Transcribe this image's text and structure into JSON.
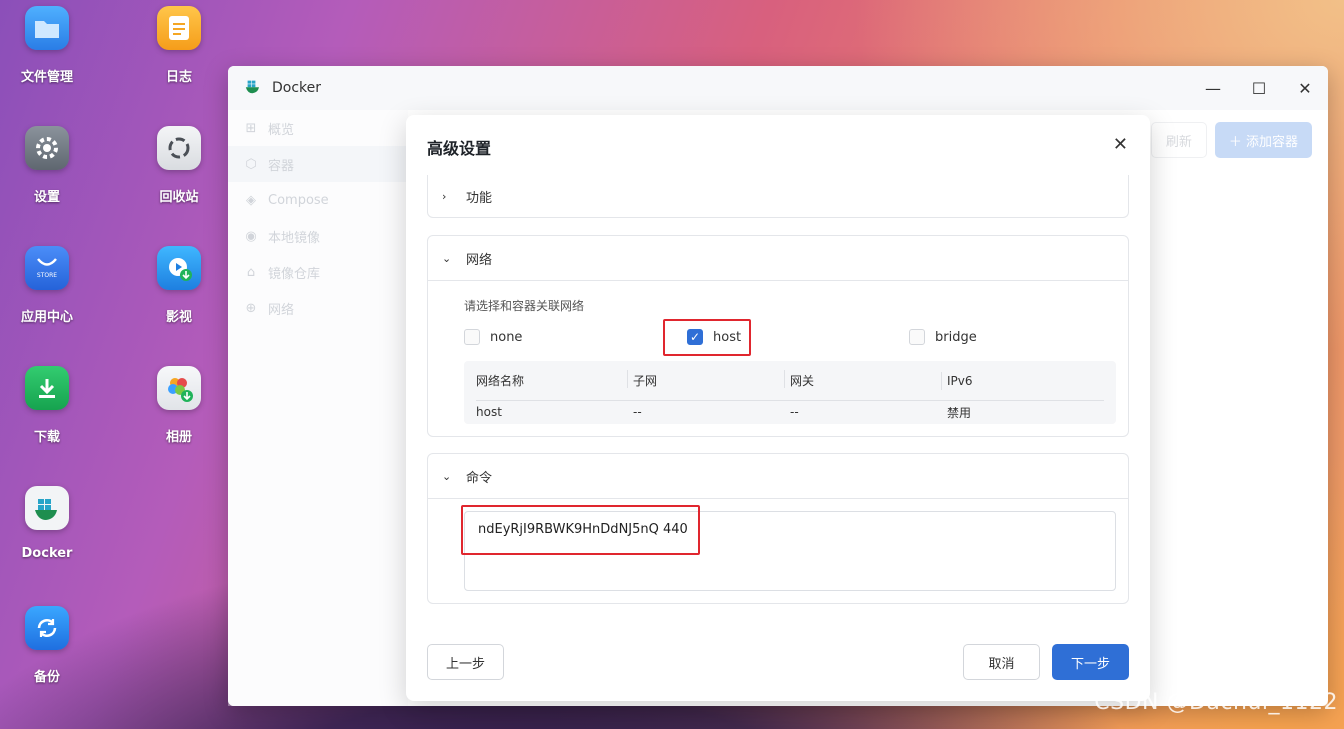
{
  "desktop": {
    "icons": [
      {
        "label": "文件管理",
        "icon": "folder-icon"
      },
      {
        "label": "日志",
        "icon": "log-icon"
      },
      {
        "label": "设置",
        "icon": "gear-icon"
      },
      {
        "label": "回收站",
        "icon": "recycle-icon"
      },
      {
        "label": "应用中心",
        "icon": "store-icon",
        "badge": "STORE"
      },
      {
        "label": "影视",
        "icon": "video-icon"
      },
      {
        "label": "下载",
        "icon": "download-icon"
      },
      {
        "label": "相册",
        "icon": "photos-icon"
      },
      {
        "label": "Docker",
        "icon": "docker-icon"
      },
      {
        "label": "备份",
        "icon": "backup-icon"
      }
    ]
  },
  "window": {
    "title": "Docker",
    "controls": {
      "minimize": "—",
      "maximize": "☐",
      "close": "✕"
    },
    "sidebar": [
      {
        "label": "概览",
        "icon": "grid-icon"
      },
      {
        "label": "容器",
        "icon": "cube-icon"
      },
      {
        "label": "Compose",
        "icon": "layers-icon"
      },
      {
        "label": "本地镜像",
        "icon": "disk-icon"
      },
      {
        "label": "镜像仓库",
        "icon": "warehouse-icon"
      },
      {
        "label": "网络",
        "icon": "globe-icon"
      }
    ],
    "toolbar": {
      "refresh": "刷新",
      "add": "＋ 添加容器"
    }
  },
  "dialog": {
    "title": "高级设置",
    "close": "✕",
    "sections": {
      "features": {
        "label": "功能"
      },
      "network": {
        "label": "网络",
        "hint": "请选择和容器关联网络",
        "options": [
          {
            "label": "none",
            "checked": false
          },
          {
            "label": "host",
            "checked": true
          },
          {
            "label": "bridge",
            "checked": false
          }
        ],
        "table": {
          "headers": [
            "网络名称",
            "子网",
            "网关",
            "IPv6"
          ],
          "rows": [
            [
              "host",
              "--",
              "--",
              "禁用"
            ]
          ]
        }
      },
      "command": {
        "label": "命令",
        "value": "ndEyRjI9RBWK9HnDdNJ5nQ 440"
      }
    },
    "buttons": {
      "prev": "上一步",
      "cancel": "取消",
      "next": "下一步"
    }
  },
  "watermark": "CSDN @Dachui_1122",
  "colors": {
    "primary": "#2f6fd6",
    "highlight": "#e0262e"
  }
}
